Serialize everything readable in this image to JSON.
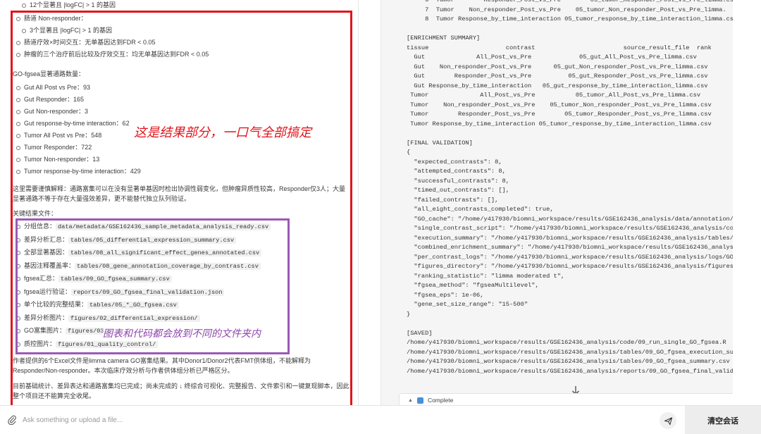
{
  "left": {
    "line_top": "12个显著且 |logFC| > 1 的基因",
    "gut_nonresp_title": "肠道 Non-responder：",
    "gut_nonresp_sub": "3个显著且 |logFC| > 1 的基因",
    "gut_interaction": "肠道疗效×时间交互：无单基因达到FDR < 0.05",
    "tumor_interaction": "肿瘤的三个治疗前后比较及疗效交互：均无单基因达到FDR < 0.05",
    "go_heading": "GO-fgsea显著通路数量：",
    "go_items": [
      "Gut All Post vs Pre：93",
      "Gut Responder：165",
      "Gut Non-responder：3",
      "Gut response-by-time interaction：62",
      "Tumor All Post vs Pre：548",
      "Tumor Responder：722",
      "Tumor Non-responder：13",
      "Tumor response-by-time interaction：429"
    ],
    "caution_para": "这里需要谨慎解释：通路富集可以在没有显著单基因时检出协调性弱变化，但肿瘤异质性较高，Responder仅3人；大量显著通路不等于存在大量强效差异，更不能替代独立队列验证。",
    "files_heading": "关键结果文件：",
    "files": [
      {
        "label": "分组信息：",
        "path": "data/metadata/GSE162436_sample_metadata_analysis_ready.csv"
      },
      {
        "label": "差异分析汇总：",
        "path": "tables/05_differential_expression_summary.csv"
      },
      {
        "label": "全部显著基因：",
        "path": "tables/08_all_significant_effect_genes_annotated.csv"
      },
      {
        "label": "基因注释覆盖率：",
        "path": "tables/08_gene_annotation_coverage_by_contrast.csv"
      },
      {
        "label": "fgsea汇总：",
        "path": "tables/09_GO_fgsea_summary.csv"
      },
      {
        "label": "fgsea运行验证：",
        "path": "reports/09_GO_fgsea_final_validation.json"
      },
      {
        "label": "单个比较的完整结果：",
        "path": "tables/05_*_GO_fgsea.csv"
      },
      {
        "label": "差异分析图片：",
        "path": "figures/02_differential_expression/"
      },
      {
        "label": "GO富集图片：",
        "path": "figures/03_..."
      },
      {
        "label": "质控图片：",
        "path": "figures/01_quality_control/"
      }
    ],
    "author_para": "作者提供的6个Excel文件是limma camera GO富集结果。其中Donor1/Donor2代表FMT供体组，不能解释为Responder/Non-responder。本次临床疗效分析与作者供体组分析已严格区分。",
    "status_para": "目前基础统计、差异表达和通路富集均已完成；尚未完成的 ↓ 终综合可视化、完整报告、文件索引和一键复现脚本，因此整个项目还不能算完全收尾。",
    "annotation_red": "这是结果部分，一口气全部搞定",
    "annotation_purple": "图表和代码都会放到不同的文件夹内"
  },
  "terminal": {
    "lines": [
      "     6  Tumor        Responder_Post_vs_Pre        05_tumor_Responder_Post_vs_Pre_limma.cs",
      "     7  Tumor    Non_responder_Post_vs_Pre    05_tumor_Non_responder_Post_vs_Pre_limma.",
      "     8  Tumor Response_by_time_interaction 05_tumor_response_by_time_interaction_limma.cs",
      "",
      "[ENRICHMENT SUMMARY]",
      "tissue                     contrast                        source_result_file  rank",
      "  Gut              All_Post_vs_Pre             05_gut_All_Post_vs_Pre_limma.csv",
      "  Gut    Non_responder_Post_vs_Pre      05_gut_Non_responder_Post_vs_Pre_limma.csv",
      "  Gut        Responder_Post_vs_Pre          05_gut_Responder_Post_vs_Pre_limma.csv",
      "  Gut Response_by_time_interaction   05_gut_response_by_time_interaction_limma.csv",
      " Tumor              All_Post_vs_Pre           05_tumor_All_Post_vs_Pre_limma.csv",
      " Tumor    Non_responder_Post_vs_Pre    05_tumor_Non_responder_Post_vs_Pre_limma.csv",
      " Tumor        Responder_Post_vs_Pre        05_tumor_Responder_Post_vs_Pre_limma.csv",
      " Tumor Response_by_time_interaction 05_tumor_response_by_time_interaction_limma.csv",
      "",
      "[FINAL VALIDATION]",
      "{",
      "  \"expected_contrasts\": 8,",
      "  \"attempted_contrasts\": 8,",
      "  \"successful_contrasts\": 8,",
      "  \"timed_out_contrasts\": [],",
      "  \"failed_contrasts\": [],",
      "  \"all_eight_contrasts_completed\": true,",
      "  \"GO_cache\": \"/home/y417930/biomni_workspace/results/GSE162436_analysis/data/annotation/",
      "  \"single_contrast_script\": \"/home/y417930/biomni_workspace/results/GSE162436_analysis/co",
      "  \"execution_summary\": \"/home/y417930/biomni_workspace/results/GSE162436_analysis/tables/",
      "  \"combined_enrichment_summary\": \"/home/y417930/biomni_workspace/results/GSE162436_analys",
      "  \"per_contrast_logs\": \"/home/y417930/biomni_workspace/results/GSE162436_analysis/logs/GO",
      "  \"figures_directory\": \"/home/y417930/biomni_workspace/results/GSE162436_analysis/figures",
      "  \"ranking_statistic\": \"limma moderated t\",",
      "  \"fgsea_method\": \"fgseaMultilevel\",",
      "  \"fgsea_eps\": 1e-06,",
      "  \"gene_set_size_range\": \"15-500\"",
      "}",
      "",
      "[SAVED]",
      "/home/y417930/biomni_workspace/results/GSE162436_analysis/code/09_run_single_GO_fgsea.R",
      "/home/y417930/biomni_workspace/results/GSE162436_analysis/tables/09_GO_fgsea_execution_su",
      "/home/y417930/biomni_workspace/results/GSE162436_analysis/tables/09_GO_fgsea_summary.csv",
      "/home/y417930/biomni_workspace/results/GSE162436_analysis/reports/09_GO_fgsea_final_valid"
    ],
    "complete_label": "Complete"
  },
  "chat": {
    "placeholder": "Ask something or upload a file...",
    "clear_label": "清空会话"
  },
  "colors": {
    "red_box": "#e2141c",
    "purple_box": "#9b59b6"
  },
  "icons": [
    "paperclip-icon",
    "send-icon",
    "arrow-down-icon",
    "chevron-icon",
    "status-icon"
  ]
}
